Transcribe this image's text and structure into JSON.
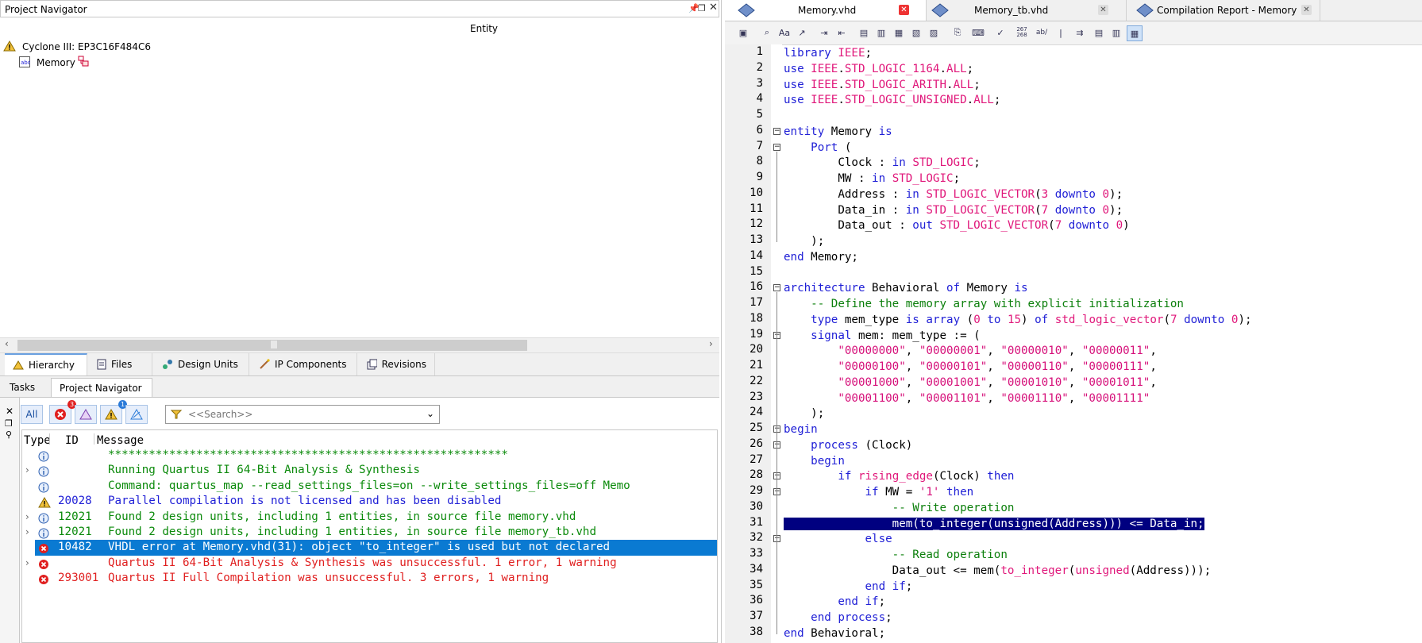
{
  "left_panel": {
    "title": "Project Navigator",
    "window_controls": [
      "pin",
      "restore",
      "close"
    ],
    "entity_header": "Entity",
    "tree": [
      {
        "label": "Cyclone III: EP3C16F484C6",
        "icon": "warning-icon"
      },
      {
        "label": "Memory",
        "icon": "entity-icon"
      }
    ],
    "nav_tabs": [
      {
        "label": "Hierarchy",
        "icon": "warning-icon"
      },
      {
        "label": "Files",
        "icon": "files-icon"
      },
      {
        "label": "Design Units",
        "icon": "design-units-icon"
      },
      {
        "label": "IP Components",
        "icon": "ip-components-icon"
      },
      {
        "label": "Revisions",
        "icon": "revisions-icon"
      }
    ],
    "sub_tabs": [
      "Tasks",
      "Project Navigator"
    ]
  },
  "messages": {
    "filter_all_label": "All",
    "error_count": "3",
    "info_count": "1",
    "search_placeholder": "<<Search>>",
    "columns": [
      "Type",
      "ID",
      "Message"
    ],
    "rows": [
      {
        "type": "info",
        "id": "",
        "text": "***********************************************************",
        "expandable": false
      },
      {
        "type": "info",
        "id": "",
        "text": "Running Quartus II 64-Bit Analysis & Synthesis",
        "expandable": true
      },
      {
        "type": "info",
        "id": "",
        "text": "Command: quartus_map --read_settings_files=on --write_settings_files=off Memo",
        "expandable": false
      },
      {
        "type": "warning",
        "id": "20028",
        "text": "Parallel compilation is not licensed and has been disabled",
        "expandable": false
      },
      {
        "type": "info",
        "id": "12021",
        "text": "Found 2 design units, including 1 entities, in source file memory.vhd",
        "expandable": true
      },
      {
        "type": "info",
        "id": "12021",
        "text": "Found 2 design units, including 1 entities, in source file memory_tb.vhd",
        "expandable": true
      },
      {
        "type": "error",
        "id": "10482",
        "text": "VHDL error at Memory.vhd(31): object \"to_integer\" is used but not declared",
        "expandable": false,
        "selected": true
      },
      {
        "type": "error",
        "id": "",
        "text": "Quartus II 64-Bit Analysis & Synthesis was unsuccessful. 1 error, 1 warning",
        "expandable": true
      },
      {
        "type": "error",
        "id": "293001",
        "text": "Quartus II Full Compilation was unsuccessful. 3 errors, 1 warning",
        "expandable": false
      }
    ]
  },
  "editor": {
    "tabs": [
      {
        "label": "Memory.vhd",
        "active": true
      },
      {
        "label": "Memory_tb.vhd",
        "active": false
      },
      {
        "label": "Compilation Report - Memory",
        "active": false
      }
    ],
    "toolbar_text": {
      "line_counter": "267\n268",
      "spell": "ab/"
    },
    "highlight_line": 31,
    "lines": [
      "library IEEE;",
      "use IEEE.STD_LOGIC_1164.ALL;",
      "use IEEE.STD_LOGIC_ARITH.ALL;",
      "use IEEE.STD_LOGIC_UNSIGNED.ALL;",
      "",
      "entity Memory is",
      "    Port (",
      "        Clock : in STD_LOGIC;",
      "        MW : in STD_LOGIC;",
      "        Address : in STD_LOGIC_VECTOR(3 downto 0);",
      "        Data_in : in STD_LOGIC_VECTOR(7 downto 0);",
      "        Data_out : out STD_LOGIC_VECTOR(7 downto 0)",
      "    );",
      "end Memory;",
      "",
      "architecture Behavioral of Memory is",
      "    -- Define the memory array with explicit initialization",
      "    type mem_type is array (0 to 15) of std_logic_vector(7 downto 0);",
      "    signal mem: mem_type := (",
      "        \"00000000\", \"00000001\", \"00000010\", \"00000011\",",
      "        \"00000100\", \"00000101\", \"00000110\", \"00000111\",",
      "        \"00001000\", \"00001001\", \"00001010\", \"00001011\",",
      "        \"00001100\", \"00001101\", \"00001110\", \"00001111\"",
      "    );",
      "begin",
      "    process (Clock)",
      "    begin",
      "        if rising_edge(Clock) then",
      "            if MW = '1' then",
      "                -- Write operation",
      "                mem(to_integer(unsigned(Address))) <= Data_in;",
      "            else",
      "                -- Read operation",
      "                Data_out <= mem(to_integer(unsigned(Address)));",
      "            end if;",
      "        end if;",
      "    end process;",
      "end Behavioral;"
    ],
    "fold_lines": [
      6,
      7,
      16,
      19,
      25,
      26,
      28,
      29,
      32
    ]
  }
}
